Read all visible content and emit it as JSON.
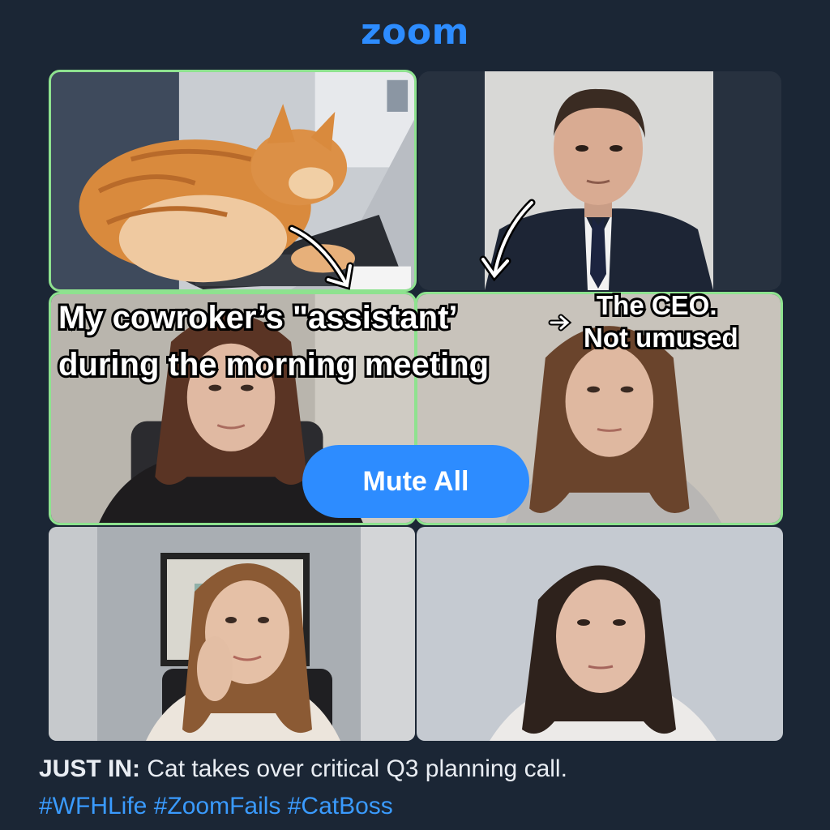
{
  "app": {
    "logo_text": "zoom"
  },
  "participants": [
    {
      "id": "cat",
      "active": true
    },
    {
      "id": "ceo",
      "active": false
    },
    {
      "id": "p3",
      "active": true
    },
    {
      "id": "p4",
      "active": true
    },
    {
      "id": "p5",
      "active": false
    },
    {
      "id": "p6",
      "active": false
    }
  ],
  "captions": {
    "main_line1": "My cowroker’s \"assistant’",
    "main_line2": "during the morning meeting",
    "ceo_line1": "The CEO.",
    "ceo_line2": "Not umused"
  },
  "controls": {
    "mute_all_label": "Mute All"
  },
  "footer": {
    "headline_prefix": "JUST IN:",
    "headline_text": " Cat takes over critical Q3 planning call.",
    "hashtags": "#WFHLife #ZoomFails #CatBoss"
  },
  "colors": {
    "background": "#1b2635",
    "brand_blue": "#2d8cff",
    "active_speaker_border": "#8ee28f",
    "hashtag_blue": "#3a9bff"
  }
}
